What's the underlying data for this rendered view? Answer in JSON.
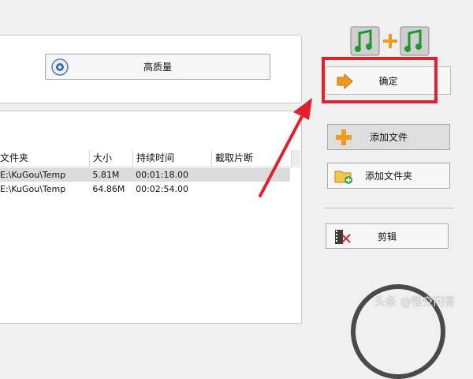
{
  "quality": {
    "label": "高质量"
  },
  "table": {
    "headers": [
      "文件夹",
      "大小",
      "持续时间",
      "截取片断"
    ],
    "rows": [
      {
        "path": "E:\\KuGou\\Temp",
        "size": "5.81M",
        "duration": "00:01:18.00",
        "cut": "",
        "selected": true
      },
      {
        "path": "E:\\KuGou\\Temp",
        "size": "64.86M",
        "duration": "00:02:54.00",
        "cut": "",
        "selected": false
      }
    ]
  },
  "actions": {
    "confirm": "确定",
    "add_file": "添加文件",
    "add_folder": "添加文件夹",
    "edit": "剪辑"
  },
  "watermark": "头条 @悟空问答",
  "colors": {
    "highlight": "#e0202a",
    "accent_orange": "#f39a1e"
  },
  "icons": [
    "music-merge-icon",
    "quality-settings-icon",
    "arrow-right-icon",
    "plus-icon",
    "folder-add-icon",
    "film-scissors-icon"
  ]
}
